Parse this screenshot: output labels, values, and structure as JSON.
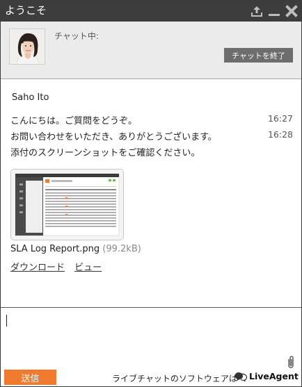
{
  "window": {
    "title": "ようこそ",
    "icons": [
      "upload-icon",
      "minimize-icon",
      "close-icon"
    ]
  },
  "agent": {
    "status_label": "チャット中:",
    "end_chat_label": "チャットを終了"
  },
  "conversation": {
    "sender": "Saho Ito",
    "messages": [
      {
        "text": "こんにちは。ご質問をどうぞ。",
        "time": "16:27"
      },
      {
        "text": "お問い合わせをいただき、ありがとうございます。",
        "time": "16:28"
      },
      {
        "text": "添付のスクリーンショットをご確認ください。",
        "time": ""
      }
    ],
    "attachment": {
      "filename": "SLA Log Report.png",
      "size": "(99.2kB)",
      "download_label": "ダウンロード",
      "view_label": "ビュー"
    }
  },
  "composer": {
    "value": ""
  },
  "footer": {
    "send_label": "送信",
    "powered_text": "ライブチャットのソフトウェアは",
    "brand": "LiveAgent"
  },
  "colors": {
    "titlebar": "#3d3d3d",
    "send_button": "#f07b2e",
    "end_chat_button": "#6d6d6d"
  }
}
